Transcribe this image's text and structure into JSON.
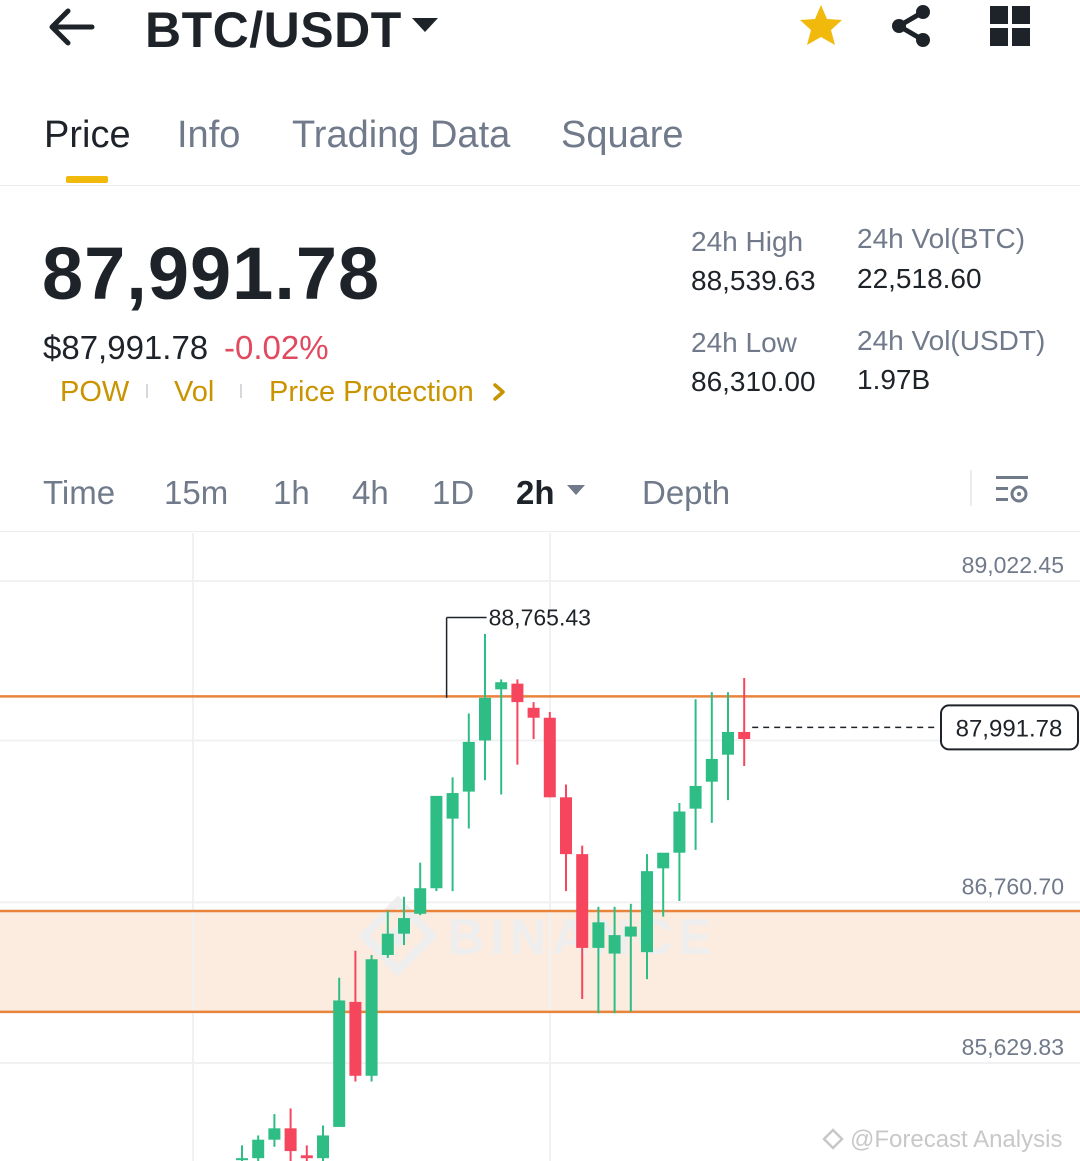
{
  "header": {
    "pair": "BTC/USDT",
    "icons": [
      "back-arrow-icon",
      "caret-down-icon",
      "star-icon",
      "share-icon",
      "grid-menu-icon"
    ],
    "star_color": "#f0b90b"
  },
  "tabs": [
    {
      "label": "Price",
      "active": true
    },
    {
      "label": "Info",
      "active": false
    },
    {
      "label": "Trading Data",
      "active": false
    },
    {
      "label": "Square",
      "active": false
    }
  ],
  "price": {
    "last": "87,991.78",
    "fiat": "$87,991.78",
    "change": "-0.02%",
    "change_color": "#e0495e"
  },
  "tags": [
    "POW",
    "Vol",
    "Price Protection"
  ],
  "stats": {
    "high_label": "24h High",
    "high_value": "88,539.63",
    "low_label": "24h Low",
    "low_value": "86,310.00",
    "vol_btc_label": "24h Vol(BTC)",
    "vol_btc_value": "22,518.60",
    "vol_usdt_label": "24h Vol(USDT)",
    "vol_usdt_value": "1.97B"
  },
  "intervals": [
    "Time",
    "15m",
    "1h",
    "4h",
    "1D",
    "2h",
    "Depth"
  ],
  "active_interval": "2h",
  "chart": {
    "axis_labels": [
      "89,022.45",
      "86,760.70",
      "85,629.83"
    ],
    "high_marker": "88,765.43",
    "current_price_tag": "87,991.78",
    "watermark": "BINANCE",
    "credit": "@Forecast Analysis",
    "colors": {
      "up": "#2ebd85",
      "down": "#f6465d",
      "level": "#e8843c",
      "zone": "#fcece0"
    }
  },
  "chart_data": {
    "type": "candlestick",
    "interval": "2h",
    "ylim": [
      84920,
      89500
    ],
    "axis_ticks": [
      89022.45,
      86760.7,
      85629.83
    ],
    "horizontal_levels": [
      88210,
      86700,
      85990
    ],
    "support_zone": [
      85990,
      86700
    ],
    "last_price": 87991.78,
    "high_marker": 88765.43,
    "candles": [
      {
        "o": 84950,
        "h": 85050,
        "l": 84920,
        "c": 84960
      },
      {
        "o": 84960,
        "h": 85120,
        "l": 84920,
        "c": 85090
      },
      {
        "o": 85090,
        "h": 85270,
        "l": 85040,
        "c": 85170
      },
      {
        "o": 85170,
        "h": 85310,
        "l": 84920,
        "c": 85010
      },
      {
        "o": 84980,
        "h": 85050,
        "l": 84920,
        "c": 84960
      },
      {
        "o": 84960,
        "h": 85190,
        "l": 84940,
        "c": 85120
      },
      {
        "o": 85180,
        "h": 86230,
        "l": 85180,
        "c": 86070
      },
      {
        "o": 86060,
        "h": 86420,
        "l": 85500,
        "c": 85540
      },
      {
        "o": 85540,
        "h": 86390,
        "l": 85500,
        "c": 86360
      },
      {
        "o": 86390,
        "h": 86700,
        "l": 86370,
        "c": 86540
      },
      {
        "o": 86540,
        "h": 86800,
        "l": 86460,
        "c": 86650
      },
      {
        "o": 86680,
        "h": 87040,
        "l": 86670,
        "c": 86860
      },
      {
        "o": 86860,
        "h": 87220,
        "l": 86840,
        "c": 87510
      },
      {
        "o": 87350,
        "h": 87640,
        "l": 86840,
        "c": 87530
      },
      {
        "o": 87540,
        "h": 88090,
        "l": 87280,
        "c": 87890
      },
      {
        "o": 87900,
        "h": 88650,
        "l": 87620,
        "c": 88200
      },
      {
        "o": 88260,
        "h": 88330,
        "l": 87520,
        "c": 88310
      },
      {
        "o": 88300,
        "h": 88330,
        "l": 87730,
        "c": 88170
      },
      {
        "o": 88130,
        "h": 88170,
        "l": 87910,
        "c": 88060
      },
      {
        "o": 88060,
        "h": 88100,
        "l": 87500,
        "c": 87500
      },
      {
        "o": 87500,
        "h": 87590,
        "l": 86840,
        "c": 87100
      },
      {
        "o": 87100,
        "h": 87160,
        "l": 86080,
        "c": 86440
      },
      {
        "o": 86440,
        "h": 86730,
        "l": 85980,
        "c": 86620
      },
      {
        "o": 86400,
        "h": 86730,
        "l": 85980,
        "c": 86530
      },
      {
        "o": 86520,
        "h": 86750,
        "l": 85990,
        "c": 86590
      },
      {
        "o": 86410,
        "h": 87100,
        "l": 86220,
        "c": 86980
      },
      {
        "o": 87000,
        "h": 87100,
        "l": 86660,
        "c": 87110
      },
      {
        "o": 87110,
        "h": 87460,
        "l": 86770,
        "c": 87400
      },
      {
        "o": 87420,
        "h": 88190,
        "l": 87130,
        "c": 87580
      },
      {
        "o": 87610,
        "h": 88240,
        "l": 87320,
        "c": 87770
      },
      {
        "o": 87800,
        "h": 88240,
        "l": 87480,
        "c": 87960
      },
      {
        "o": 87960,
        "h": 88340,
        "l": 87720,
        "c": 87910
      }
    ]
  }
}
